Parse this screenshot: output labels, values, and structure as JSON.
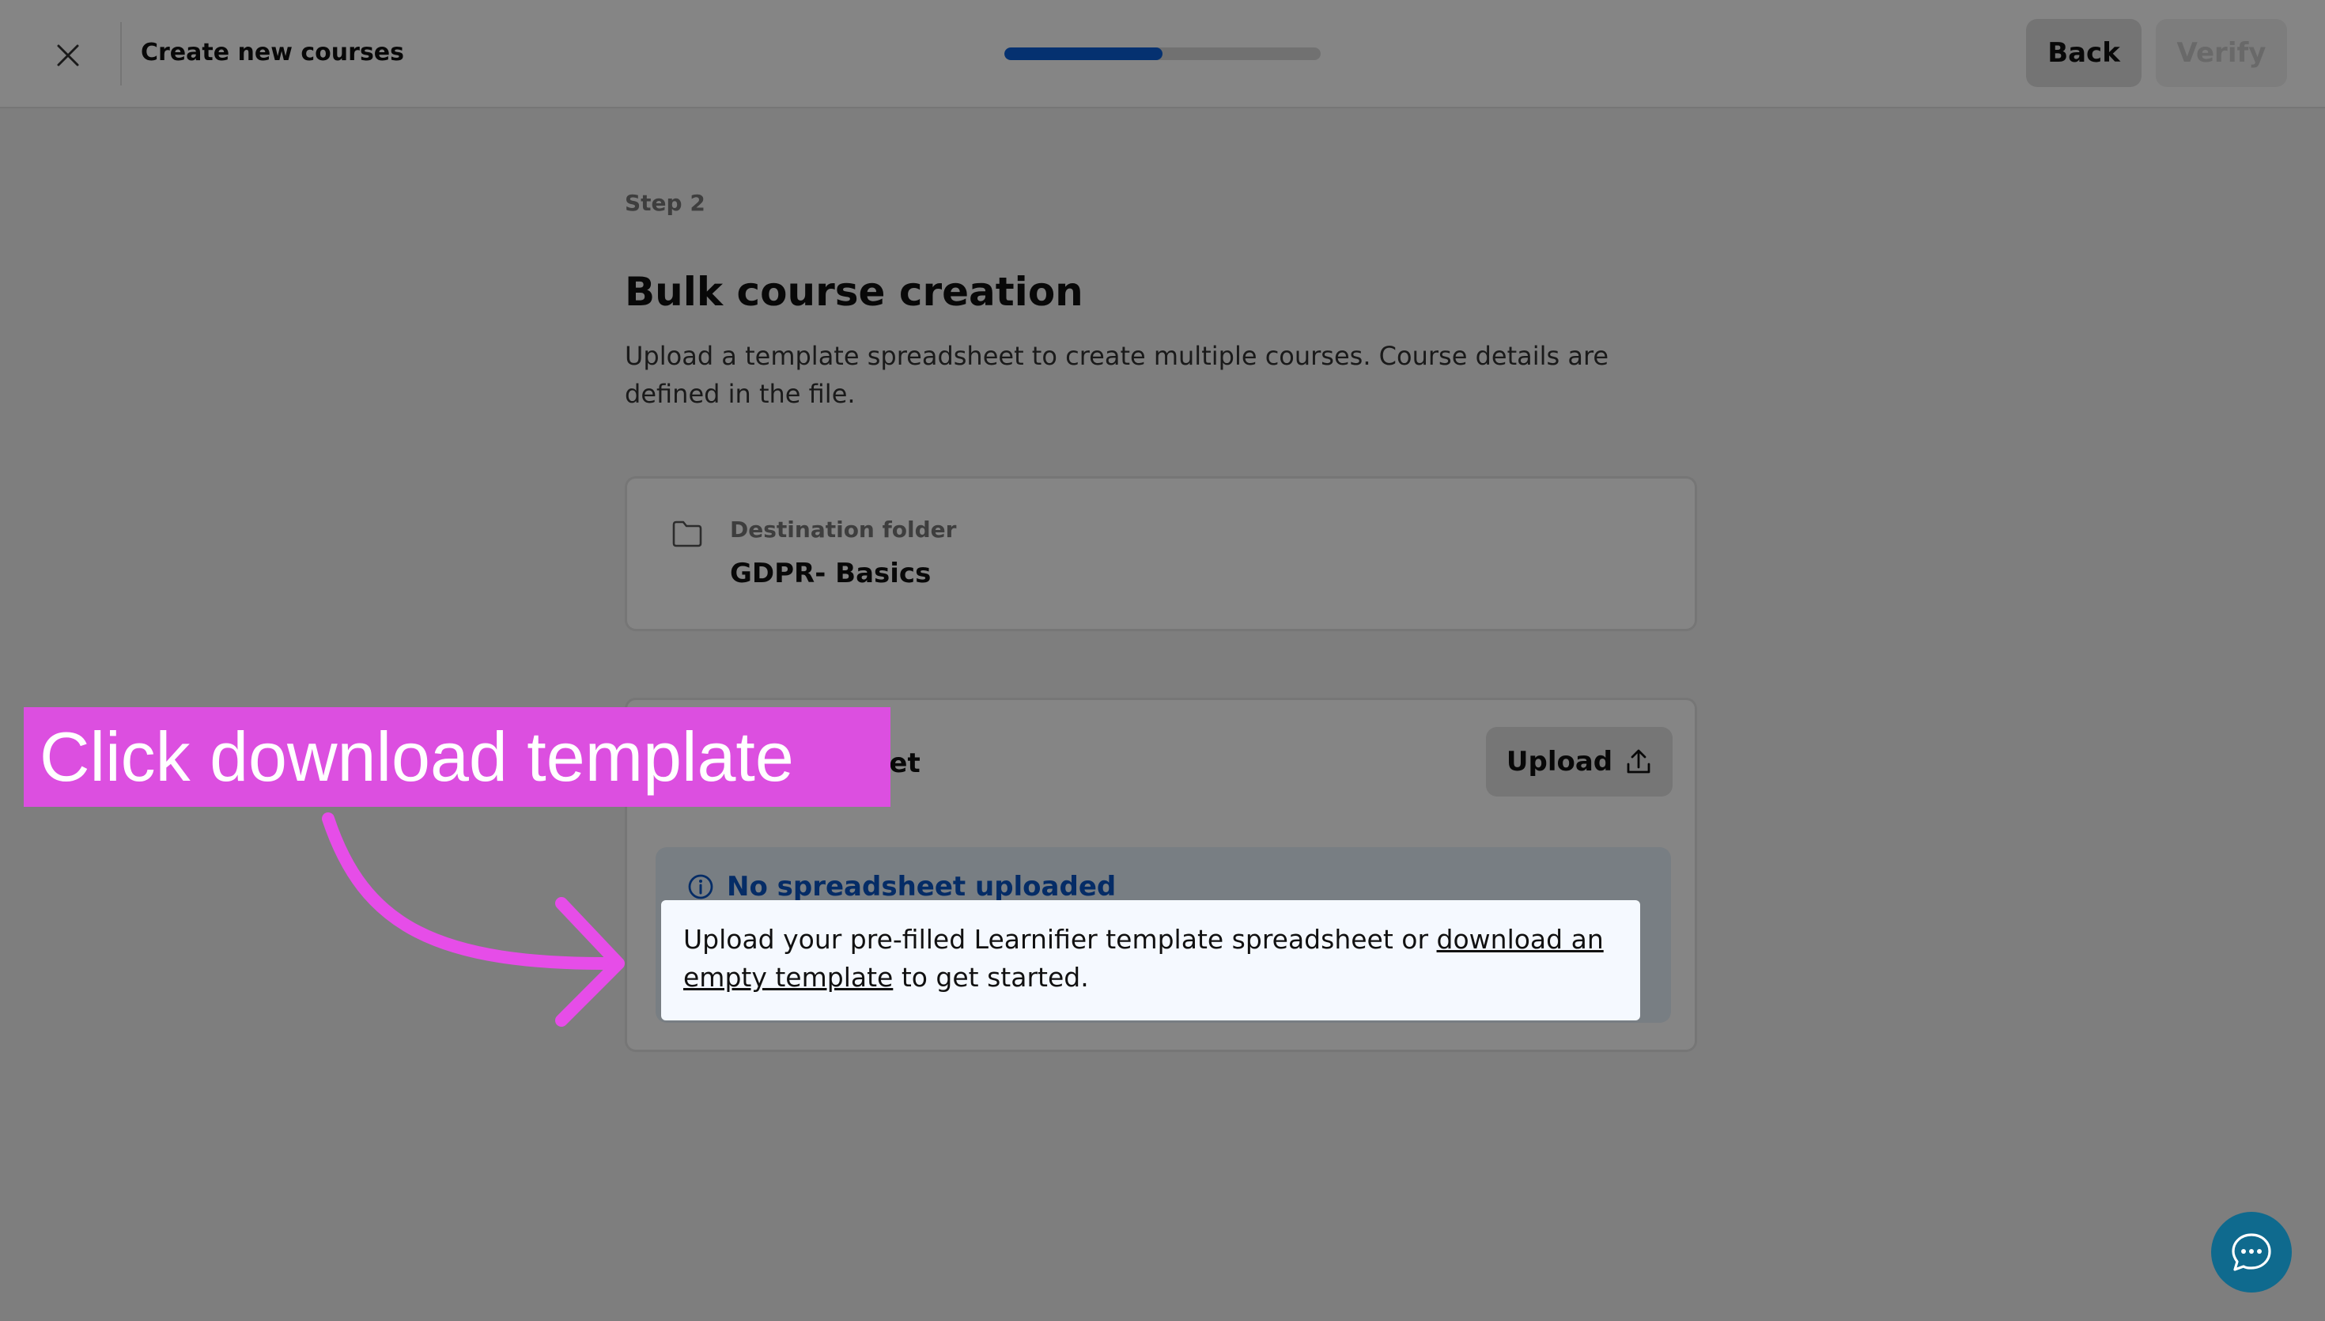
{
  "header": {
    "title": "Create new courses",
    "progress": 0.5,
    "back_label": "Back",
    "verify_label": "Verify"
  },
  "main": {
    "step_label": "Step 2",
    "title": "Bulk course creation",
    "description": "Upload a template spreadsheet to create multiple courses. Course details are defined in the file.",
    "destination": {
      "label": "Destination folder",
      "value": "GDPR- Basics"
    },
    "spreadsheet": {
      "title": "Spreadsheet",
      "upload_label": "Upload",
      "info_title": "No spreadsheet uploaded",
      "info_text_before": "Upload your pre-filled Learnifier template spreadsheet or ",
      "info_link": "download an empty template",
      "info_text_after": " to get started."
    }
  },
  "callout": {
    "label": "Click download template"
  },
  "colors": {
    "accent": "#0a5fd6",
    "callout": "#dc4fe0",
    "chat": "#0f6a8e"
  }
}
